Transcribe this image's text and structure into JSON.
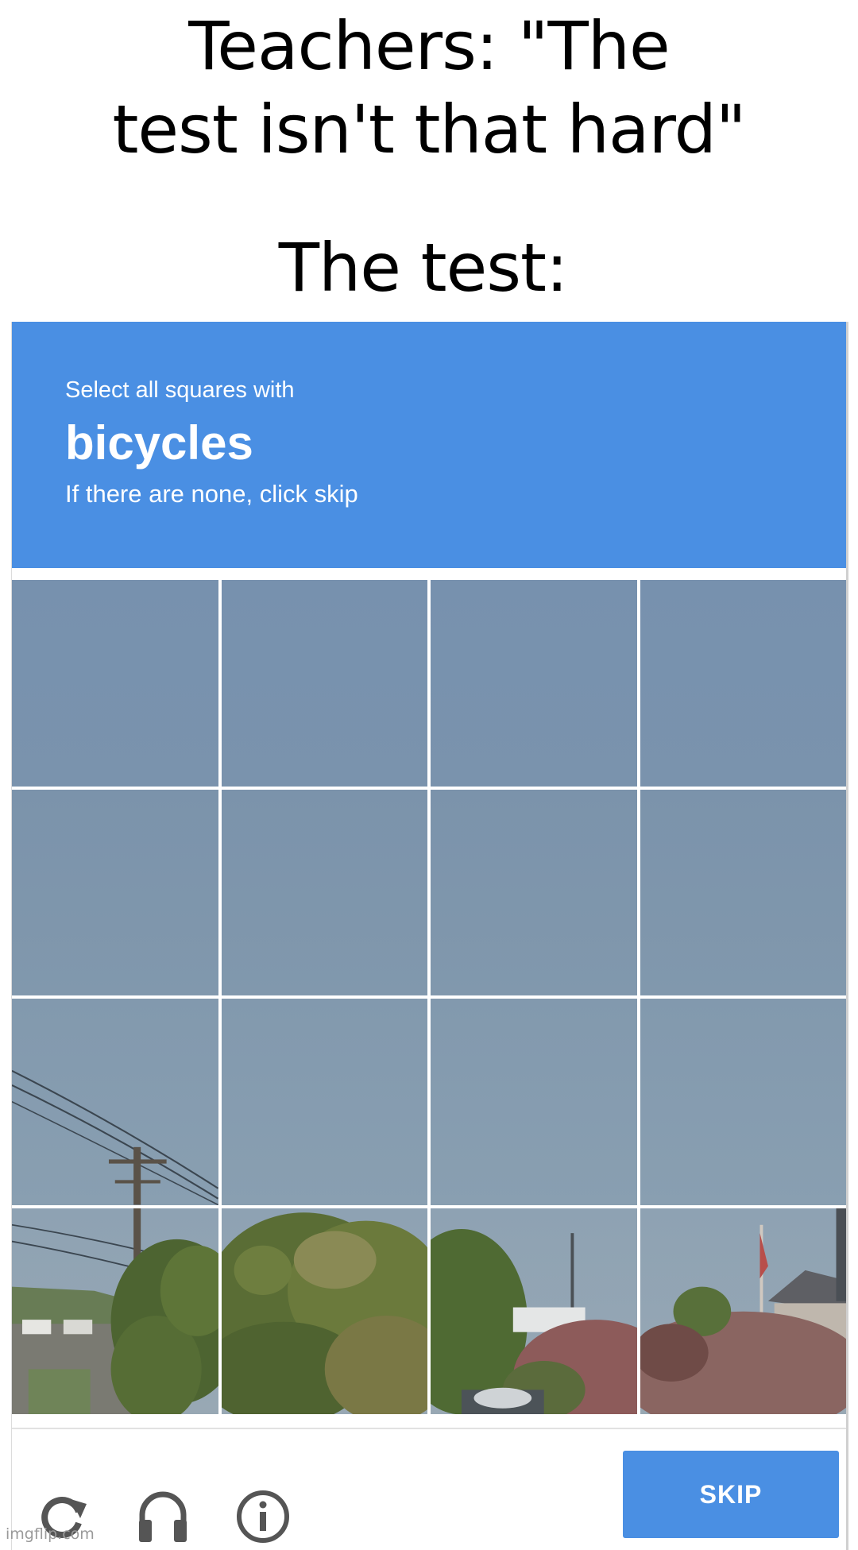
{
  "meme": {
    "title_line1": "Teachers: \"The",
    "title_line2": "test isn't that hard\"",
    "subtitle": "The test:"
  },
  "captcha": {
    "instruction": "Select all squares with",
    "target": "bicycles",
    "note": "If there are none, click skip",
    "grid": {
      "rows": 4,
      "cols": 4
    },
    "icons": [
      "reload-icon",
      "headphones-icon",
      "info-icon"
    ],
    "skip_label": "SKIP",
    "colors": {
      "accent": "#4a8fe3",
      "sky": "#7a93ad"
    }
  },
  "watermark": "imgflip.com"
}
